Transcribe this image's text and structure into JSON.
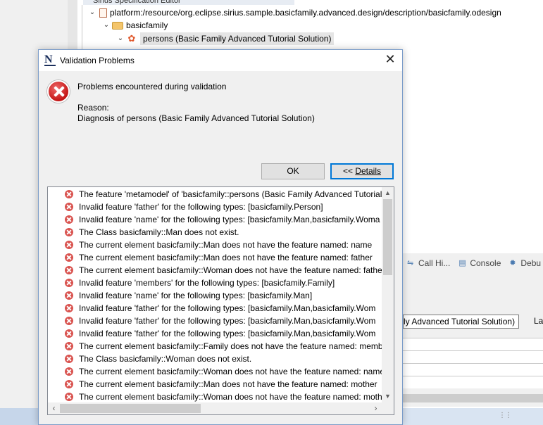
{
  "background": {
    "editor_tab": "Sirius Specification Editor",
    "tree": [
      {
        "text": "platform:/resource/org.eclipse.sirius.sample.basicfamily.advanced.design/description/basicfamily.odesign",
        "icon": "resource-file-icon"
      },
      {
        "text": "basicfamily",
        "icon": "folder-icon"
      },
      {
        "text": "persons (Basic Family Advanced Tutorial Solution)",
        "icon": "viewpoint-icon",
        "selected": true
      }
    ],
    "view_tabs": [
      "Call Hi...",
      "Console",
      "Debu"
    ],
    "property_value": "ly Advanced Tutorial Solution)",
    "property_label": "La"
  },
  "dialog": {
    "title": "Validation Problems",
    "message": "Problems encountered during validation",
    "reason_label": "Reason:",
    "reason_text": "Diagnosis of persons (Basic Family Advanced Tutorial Solution)",
    "ok_label": "OK",
    "details_prefix": "<< ",
    "details_label": "Details",
    "problems": [
      "The feature 'metamodel' of 'basicfamily::persons (Basic Family Advanced Tutorial",
      "Invalid feature 'father' for the following types: [basicfamily.Person]",
      "Invalid feature 'name' for the following types: [basicfamily.Man,basicfamily.Woma",
      "The Class basicfamily::Man does not exist.",
      "The current element basicfamily::Man does not have the feature named: name",
      "The current element basicfamily::Man does not have the feature named: father",
      "The current element basicfamily::Woman does not have the feature named: father",
      "Invalid feature 'members' for the following types: [basicfamily.Family]",
      "Invalid feature 'name' for the following types: [basicfamily.Man]",
      "Invalid feature 'father' for the following types: [basicfamily.Man,basicfamily.Wom",
      "Invalid feature 'father' for the following types: [basicfamily.Man,basicfamily.Wom",
      "Invalid feature 'father' for the following types: [basicfamily.Man,basicfamily.Wom",
      "The current element basicfamily::Family does not have the feature named: memb",
      "The Class basicfamily::Woman does not exist.",
      "The current element basicfamily::Woman does not have the feature named: name",
      "The current element basicfamily::Man does not have the feature named: mother",
      "The current element basicfamily::Woman does not have the feature named: moth"
    ]
  }
}
